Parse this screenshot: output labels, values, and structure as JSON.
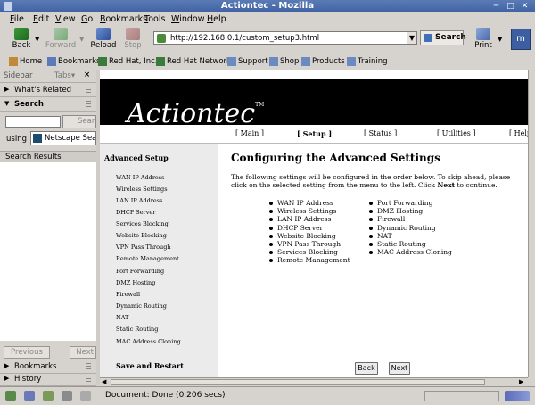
{
  "window": {
    "title": "Actiontec - Mozilla"
  },
  "menubar": {
    "items": [
      "File",
      "Edit",
      "View",
      "Go",
      "Bookmarks",
      "Tools",
      "Window",
      "Help"
    ],
    "mnemonics": [
      "F",
      "E",
      "V",
      "G",
      "B",
      "T",
      "W",
      "H"
    ],
    "rests": [
      "ile",
      "dit",
      "iew",
      "o",
      "ookmarks",
      "ools",
      "indow",
      "elp"
    ]
  },
  "navbar": {
    "back": "Back",
    "forward": "Forward",
    "reload": "Reload",
    "stop": "Stop",
    "url": "http://192.168.0.1/custom_setup3.html",
    "search": "Search",
    "print": "Print"
  },
  "personal_toolbar": {
    "items": [
      "Home",
      "Bookmarks",
      "Red Hat, Inc.",
      "Red Hat Network",
      "Support",
      "Shop",
      "Products",
      "Training"
    ]
  },
  "sidebar": {
    "title": "Sidebar",
    "tabs_label": "Tabs▾",
    "close": "×",
    "whats_related": "What's Related",
    "search_panel": "Search",
    "search_button": "Search",
    "using_label": "using",
    "engine": "Netscape Sea...",
    "results_header": "Search Results",
    "previous": "Previous",
    "next": "Next",
    "bookmarks": "Bookmarks",
    "history": "History"
  },
  "page": {
    "logo_text": "Actiontec",
    "logo_tm": "TM",
    "topnav": [
      "[ Main ]",
      "[ Setup ]",
      "[ Status ]",
      "[ Utilities ]",
      "[ Help ]"
    ],
    "left_header": "Advanced Setup",
    "left_items": [
      "WAN IP Address",
      "Wireless Settings",
      "LAN IP Address",
      "DHCP Server",
      "Services Blocking",
      "Website Blocking",
      "VPN Pass Through",
      "Remote Management",
      "Port Forwarding",
      "DMZ Hosting",
      "Firewall",
      "Dynamic Routing",
      "NAT",
      "Static Routing",
      "MAC Address Cloning"
    ],
    "left_footer": "Save and Restart",
    "heading": "Configuring the Advanced Settings",
    "intro_pre": "The following settings will be configured in the order below. To skip ahead, please click on the selected setting from the menu to the left. Click ",
    "intro_bold": "Next",
    "intro_post": " to continue.",
    "list_col1": [
      "WAN IP Address",
      "Wireless Settings",
      "LAN IP Address",
      "DHCP Server",
      "Website Blocking",
      "VPN Pass Through",
      "Services Blocking",
      "Remote Management"
    ],
    "list_col2": [
      "Port Forwarding",
      "DMZ Hosting",
      "Firewall",
      "Dynamic Routing",
      "NAT",
      "Static Routing",
      "MAC Address Cloning"
    ],
    "back_button": "Back",
    "next_button": "Next"
  },
  "statusbar": {
    "text": "Document: Done (0.206 secs)"
  },
  "colors": {
    "titlebar": "#4a6cad",
    "chrome": "#d6d3ce",
    "banner": "#000000",
    "leftmenu_bg": "#ebebeb"
  }
}
